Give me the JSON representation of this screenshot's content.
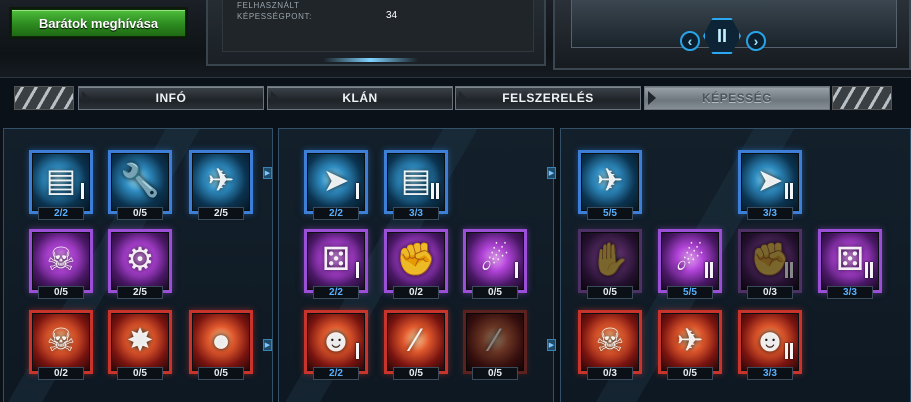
{
  "header": {
    "invite_button": "Barátok meghívása",
    "stat_label": "FELHASZNÁLT KÉPESSÉGPONT:",
    "stat_value": "34",
    "prev_arrow": "‹",
    "next_arrow": "›",
    "pause_glyph": "II"
  },
  "tabs": [
    {
      "label": "INFÓ",
      "active": false
    },
    {
      "label": "KLÁN",
      "active": false
    },
    {
      "label": "FELSZERELÉS",
      "active": false
    },
    {
      "label": "KÉPESSÉG",
      "active": true
    }
  ],
  "panels": [
    {
      "skills": [
        {
          "icon": "armor-plates-icon",
          "glyph": "▤",
          "color": "blue",
          "count": "2/2",
          "level": 1,
          "full": true
        },
        {
          "icon": "wrench-icon",
          "glyph": "🔧",
          "color": "blue",
          "count": "0/5",
          "level": 0,
          "full": false
        },
        {
          "icon": "starfighter-icon",
          "glyph": "✈",
          "color": "blue",
          "count": "2/5",
          "level": 0,
          "full": false
        },
        {
          "icon": "pirate-captain-icon",
          "glyph": "☠",
          "color": "purple",
          "count": "0/5",
          "level": 0,
          "full": false
        },
        {
          "icon": "robot-arm-icon",
          "glyph": "⚙",
          "color": "purple",
          "count": "2/5",
          "level": 0,
          "full": false
        },
        {
          "icon": "skull-emblem-icon",
          "glyph": "☠",
          "color": "red",
          "count": "0/2",
          "level": 0,
          "full": false
        },
        {
          "icon": "explosion-icon",
          "glyph": "✸",
          "color": "red",
          "count": "0/5",
          "level": 0,
          "full": false
        },
        {
          "icon": "red-planet-fleet-icon",
          "glyph": "●",
          "color": "red",
          "count": "0/5",
          "level": 0,
          "full": false
        }
      ]
    },
    {
      "skills": [
        {
          "icon": "interceptor-icon",
          "glyph": "➤",
          "color": "blue",
          "count": "2/2",
          "level": 1,
          "full": true
        },
        {
          "icon": "armor-plates-icon",
          "glyph": "▤",
          "color": "blue",
          "count": "3/3",
          "level": 2,
          "full": true
        },
        {
          "icon": "dice-icon",
          "glyph": "⚄",
          "color": "purple",
          "count": "2/2",
          "level": 1,
          "full": true
        },
        {
          "icon": "fist-icon",
          "glyph": "✊",
          "color": "purple",
          "count": "0/2",
          "level": 0,
          "full": false
        },
        {
          "icon": "asteroid-icon",
          "glyph": "☄",
          "color": "purple",
          "count": "0/5",
          "level": 1,
          "full": false
        },
        {
          "icon": "mohawk-officer-icon",
          "glyph": "☻",
          "color": "red",
          "count": "2/2",
          "level": 1,
          "full": true
        },
        {
          "icon": "rifle-icon",
          "glyph": "⁄",
          "color": "red",
          "count": "0/5",
          "level": 0,
          "full": false
        },
        {
          "icon": "rocket-launcher-icon",
          "glyph": "⁄",
          "color": "red",
          "count": "0/5",
          "level": 0,
          "full": false
        }
      ]
    },
    {
      "skills": [
        {
          "icon": "fighter-squadron-icon",
          "glyph": "✈",
          "color": "blue",
          "count": "5/5",
          "level": 0,
          "full": true
        },
        {
          "icon": "interceptor-icon",
          "glyph": "➤",
          "color": "blue",
          "count": "3/3",
          "level": 2,
          "full": true
        },
        {
          "icon": "grabbing-hand-icon",
          "glyph": "✋",
          "color": "purple",
          "count": "0/5",
          "level": 0,
          "full": false
        },
        {
          "icon": "asteroid-icon",
          "glyph": "☄",
          "color": "purple",
          "count": "5/5",
          "level": 2,
          "full": true
        },
        {
          "icon": "fist-icon",
          "glyph": "✊",
          "color": "purple",
          "count": "0/3",
          "level": 2,
          "full": false
        },
        {
          "icon": "dice-icon",
          "glyph": "⚄",
          "color": "purple",
          "count": "3/3",
          "level": 2,
          "full": true
        },
        {
          "icon": "skull-emblem-icon",
          "glyph": "☠",
          "color": "red",
          "count": "0/3",
          "level": 0,
          "full": false
        },
        {
          "icon": "bomber-ship-icon",
          "glyph": "✈",
          "color": "red",
          "count": "0/5",
          "level": 0,
          "full": false
        },
        {
          "icon": "mohawk-officer-icon",
          "glyph": "☻",
          "color": "red",
          "count": "3/3",
          "level": 2,
          "full": true
        }
      ]
    }
  ]
}
